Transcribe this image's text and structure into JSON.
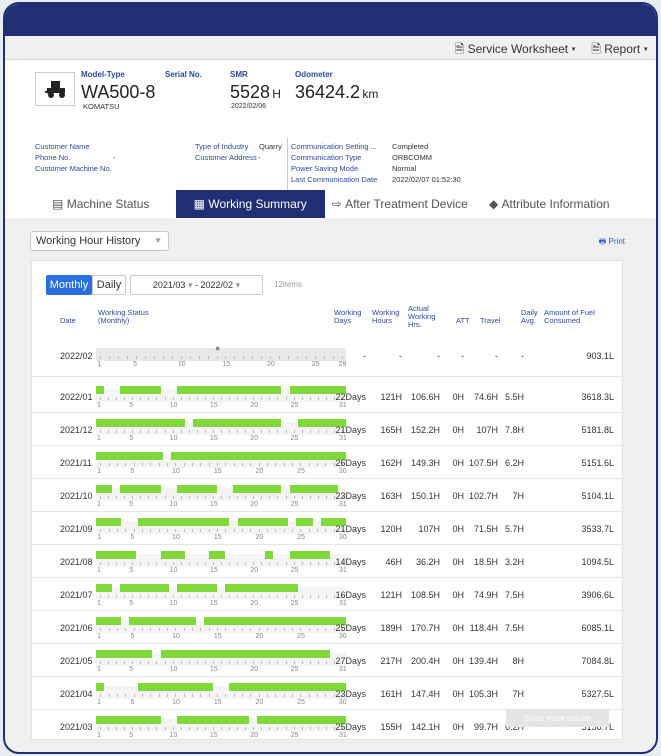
{
  "toolbar": {
    "service_worksheet": "Service Worksheet",
    "report": "Report"
  },
  "machine": {
    "model_type_label": "Model-Type",
    "serial_label": "Serial No.",
    "smr_label": "SMR",
    "odometer_label": "Odometer",
    "model": "WA500-8",
    "maker": "KOMATSU",
    "smr_value": "5528",
    "smr_unit": "H",
    "smr_date": "2022/02/06",
    "odometer_value": "36424.2",
    "odometer_unit": "km"
  },
  "details": {
    "customer_name": "Customer Name",
    "phone": "Phone No.",
    "phone_val": "-",
    "customer_machine": "Customer Machine No.",
    "industry_label": "Type of Industry",
    "industry_val": "Quarry",
    "address_label": "Customer Address",
    "address_val": "-",
    "comm_setting_label": "Communication Setting ...",
    "comm_setting_val": "Completed",
    "comm_type_label": "Communication Type",
    "comm_type_val": "ORBCOMM",
    "power_label": "Power Saving Mode",
    "power_val": "Normal",
    "last_comm_label": "Last Communication Date",
    "last_comm_val": "2022/02/07 01:52:30"
  },
  "tabs": [
    "Machine Status",
    "Working Summary",
    "After Treatment Device",
    "Attribute Information"
  ],
  "working_hour_select": "Working Hour History",
  "print_label": "Print",
  "controls": {
    "monthly": "Monthly",
    "daily": "Daily",
    "from": "2021/03",
    "sep": "-",
    "to": "2022/02",
    "items": "12items"
  },
  "headers": {
    "date": "Date",
    "status": "Working Status (Monthly)",
    "wdays": "Working Days",
    "whours": "Working Hours",
    "actual": "Actual Working Hrs.",
    "att": "ATT",
    "travel": "Travel",
    "avg": "Daily Avg.",
    "fuel": "Amount of Fuel Consumed"
  },
  "rows": [
    {
      "date": "2022/02",
      "days": 28,
      "wdays": "-",
      "whours": "-",
      "actual": "-",
      "att": "-",
      "travel": "-",
      "avg": "-",
      "fuel": "903.1L",
      "segments": []
    },
    {
      "date": "2022/01",
      "days": 31,
      "wdays": "22Days",
      "whours": "121H",
      "actual": "106.6H",
      "att": "0H",
      "travel": "74.6H",
      "avg": "5.5H",
      "fuel": "3618.3L",
      "segments": [
        [
          1,
          1
        ],
        [
          4,
          8
        ],
        [
          11,
          15
        ],
        [
          16,
          23
        ],
        [
          25,
          28
        ],
        [
          29,
          31
        ]
      ]
    },
    {
      "date": "2021/12",
      "days": 31,
      "wdays": "21Days",
      "whours": "165H",
      "actual": "152.2H",
      "att": "0H",
      "travel": "107H",
      "avg": "7.8H",
      "fuel": "5181.8L",
      "segments": [
        [
          1,
          1
        ],
        [
          2,
          4
        ],
        [
          5,
          11
        ],
        [
          13,
          17
        ],
        [
          18,
          23
        ],
        [
          26,
          31
        ]
      ]
    },
    {
      "date": "2021/11",
      "days": 30,
      "wdays": "26Days",
      "whours": "162H",
      "actual": "149.3H",
      "att": "0H",
      "travel": "107.5H",
      "avg": "6.2H",
      "fuel": "5151.6L",
      "segments": [
        [
          1,
          8
        ],
        [
          10,
          14
        ],
        [
          15,
          21
        ],
        [
          22,
          28
        ],
        [
          29,
          30
        ]
      ]
    },
    {
      "date": "2021/10",
      "days": 31,
      "wdays": "23Days",
      "whours": "163H",
      "actual": "150.1H",
      "att": "0H",
      "travel": "102.7H",
      "avg": "7H",
      "fuel": "5104.1L",
      "segments": [
        [
          1,
          2
        ],
        [
          4,
          8
        ],
        [
          11,
          15
        ],
        [
          18,
          23
        ],
        [
          25,
          30
        ]
      ]
    },
    {
      "date": "2021/09",
      "days": 30,
      "wdays": "21Days",
      "whours": "120H",
      "actual": "107H",
      "att": "0H",
      "travel": "71.5H",
      "avg": "5.7H",
      "fuel": "3533.7L",
      "segments": [
        [
          1,
          3
        ],
        [
          6,
          11
        ],
        [
          12,
          16
        ],
        [
          18,
          23
        ],
        [
          25,
          26
        ],
        [
          28,
          30
        ]
      ]
    },
    {
      "date": "2021/08",
      "days": 31,
      "wdays": "14Days",
      "whours": "46H",
      "actual": "36.2H",
      "att": "0H",
      "travel": "18.5H",
      "avg": "3.2H",
      "fuel": "1094.5L",
      "segments": [
        [
          1,
          3
        ],
        [
          4,
          5
        ],
        [
          9,
          11
        ],
        [
          15,
          16
        ],
        [
          22,
          22
        ],
        [
          25,
          29
        ]
      ]
    },
    {
      "date": "2021/07",
      "days": 31,
      "wdays": "16Days",
      "whours": "121H",
      "actual": "108.5H",
      "att": "0H",
      "travel": "74.9H",
      "avg": "7.5H",
      "fuel": "3906.6L",
      "segments": [
        [
          1,
          2
        ],
        [
          4,
          9
        ],
        [
          11,
          15
        ],
        [
          17,
          25
        ]
      ]
    },
    {
      "date": "2021/06",
      "days": 30,
      "wdays": "25Days",
      "whours": "189H",
      "actual": "170.7H",
      "att": "0H",
      "travel": "118.4H",
      "avg": "7.5H",
      "fuel": "6085.1L",
      "segments": [
        [
          1,
          3
        ],
        [
          5,
          12
        ],
        [
          14,
          16
        ],
        [
          17,
          23
        ],
        [
          24,
          30
        ]
      ]
    },
    {
      "date": "2021/05",
      "days": 31,
      "wdays": "27Days",
      "whours": "217H",
      "actual": "200.4H",
      "att": "0H",
      "travel": "139.4H",
      "avg": "8H",
      "fuel": "7084.8L",
      "segments": [
        [
          1,
          7
        ],
        [
          9,
          14
        ],
        [
          15,
          23
        ],
        [
          24,
          29
        ]
      ]
    },
    {
      "date": "2021/04",
      "days": 30,
      "wdays": "23Days",
      "whours": "161H",
      "actual": "147.4H",
      "att": "0H",
      "travel": "105.3H",
      "avg": "7H",
      "fuel": "5327.5L",
      "segments": [
        [
          1,
          1
        ],
        [
          6,
          14
        ],
        [
          17,
          23
        ],
        [
          24,
          27
        ],
        [
          28,
          30
        ]
      ]
    },
    {
      "date": "2021/03",
      "days": 31,
      "wdays": "25Days",
      "whours": "155H",
      "actual": "142.1H",
      "att": "0H",
      "travel": "99.7H",
      "avg": "6.2H",
      "fuel": "5158.7L",
      "segments": [
        [
          1,
          8
        ],
        [
          11,
          15
        ],
        [
          16,
          19
        ],
        [
          21,
          27
        ],
        [
          28,
          31
        ]
      ]
    }
  ],
  "show_more": "Show more results"
}
